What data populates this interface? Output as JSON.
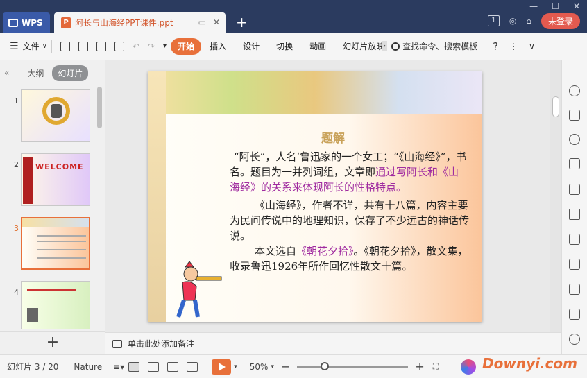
{
  "titlebar": {
    "app_label": "WPS",
    "doc_tab": "阿长与山海经PPT课件.ppt",
    "badge": "1",
    "login": "未登录"
  },
  "menu": {
    "file": "文件",
    "items": [
      "开始",
      "插入",
      "设计",
      "切换",
      "动画",
      "幻灯片放映"
    ],
    "search": "查找命令、搜索模板"
  },
  "left_panel": {
    "tab_outline": "大纲",
    "tab_slides": "幻灯片",
    "thumbnails": [
      {
        "num": "1",
        "selected": false
      },
      {
        "num": "2",
        "selected": false,
        "text": "WELCOME"
      },
      {
        "num": "3",
        "selected": true
      },
      {
        "num": "4",
        "selected": false
      }
    ]
  },
  "slide": {
    "title": "题解",
    "para1_a": "“阿长”，人名‘鲁迅家的一个女工；“《山海经》”，书名。题目为一并列词组，文章即",
    "para1_hl": "通过写阿长和《山海经》的关系来体现阿长的性格特点。",
    "para2": "《山海经》，作者不详，共有十八篇，内容主要为民间传说中的地理知识，保存了不少远古的神话传说。",
    "para3_a": "本文选自",
    "para3_hl": "《朝花夕拾》",
    "para3_b": "。《朝花夕拾》，散文集，收录鲁迅1926年所作回忆性散文十篇。"
  },
  "notes": {
    "placeholder": "单击此处添加备注"
  },
  "status": {
    "slide_count": "幻灯片 3 / 20",
    "theme": "Nature",
    "zoom": "50%",
    "zoom_level": 0.25,
    "watermark": "Downyi.com"
  },
  "colors": {
    "accent": "#e8703a",
    "titlebar": "#2b3b5f",
    "highlight": "#a02ca0"
  }
}
